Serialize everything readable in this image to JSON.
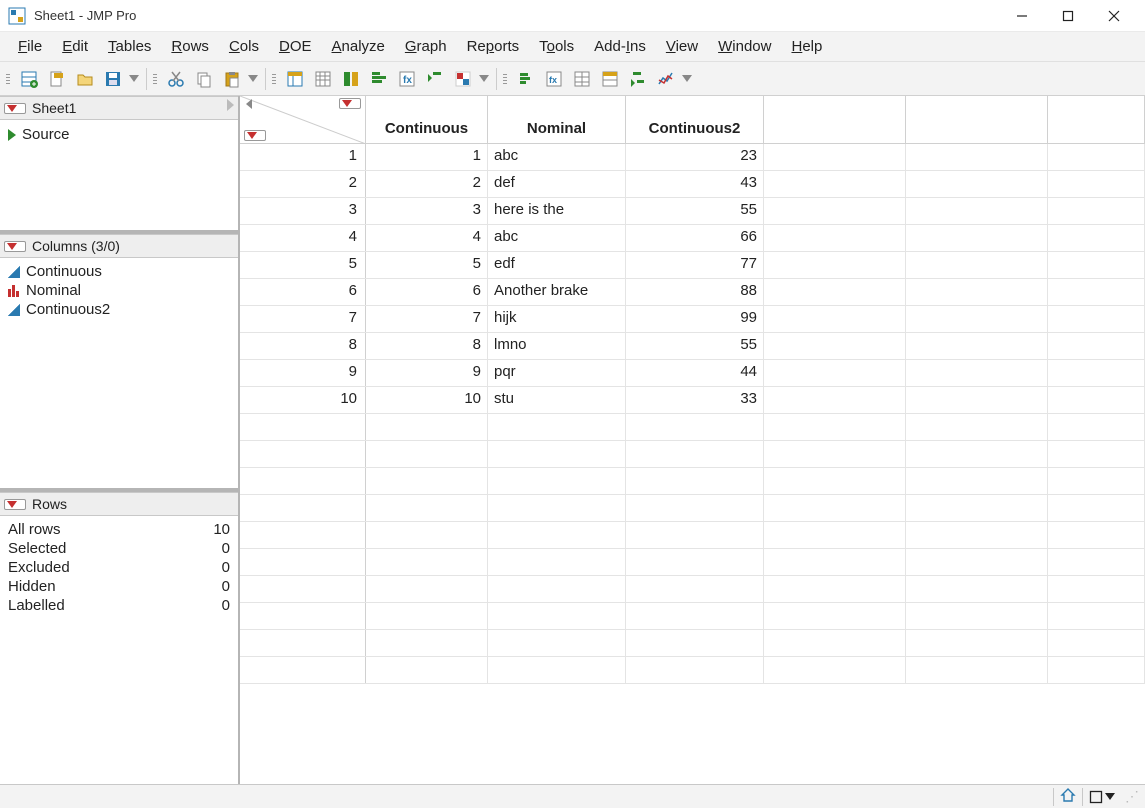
{
  "title": "Sheet1 - JMP Pro",
  "menus": [
    "File",
    "Edit",
    "Tables",
    "Rows",
    "Cols",
    "DOE",
    "Analyze",
    "Graph",
    "Reports",
    "Tools",
    "Add-Ins",
    "View",
    "Window",
    "Help"
  ],
  "menus_accel": [
    "F",
    "E",
    "T",
    "R",
    "C",
    "D",
    "A",
    "G",
    "p",
    "o",
    "I",
    "V",
    "W",
    "H"
  ],
  "toolbar_icons": [
    "new-table-icon",
    "new-script-icon",
    "open-icon",
    "save-icon",
    "cut-icon",
    "copy-icon",
    "paste-icon",
    "show-panels-icon",
    "show-header-icon",
    "split-icon",
    "arrange-icon",
    "formula-icon",
    "selection-icon",
    "color-icon",
    "distribution-icon",
    "fit-y-icon",
    "tabulate-icon",
    "summary-icon",
    "graph-builder-icon",
    "chart-icon"
  ],
  "sheet_name": "Sheet1",
  "source_label": "Source",
  "columns_panel_title": "Columns (3/0)",
  "columns": [
    {
      "name": "Continuous",
      "type": "continuous"
    },
    {
      "name": "Nominal",
      "type": "nominal"
    },
    {
      "name": "Continuous2",
      "type": "continuous"
    }
  ],
  "rows_panel_title": "Rows",
  "row_stats": {
    "All rows": "10",
    "Selected": "0",
    "Excluded": "0",
    "Hidden": "0",
    "Labelled": "0"
  },
  "headers": [
    "Continuous",
    "Nominal",
    "Continuous2"
  ],
  "data_rows": [
    {
      "n": "1",
      "c1": "1",
      "c2": "abc",
      "c3": "23"
    },
    {
      "n": "2",
      "c1": "2",
      "c2": "def",
      "c3": "43"
    },
    {
      "n": "3",
      "c1": "3",
      "c2": "here is the",
      "c3": "55"
    },
    {
      "n": "4",
      "c1": "4",
      "c2": "abc",
      "c3": "66"
    },
    {
      "n": "5",
      "c1": "5",
      "c2": "edf",
      "c3": "77"
    },
    {
      "n": "6",
      "c1": "6",
      "c2": "Another brake",
      "c3": "88"
    },
    {
      "n": "7",
      "c1": "7",
      "c2": "hijk",
      "c3": "99"
    },
    {
      "n": "8",
      "c1": "8",
      "c2": "lmno",
      "c3": "55"
    },
    {
      "n": "9",
      "c1": "9",
      "c2": "pqr",
      "c3": "44"
    },
    {
      "n": "10",
      "c1": "10",
      "c2": "stu",
      "c3": "33"
    }
  ],
  "empty_rows": 10,
  "icon_colors": {
    "accent": "#2a7ab0",
    "red": "#c53030",
    "green": "#2e8b2e",
    "gold": "#d6a21a",
    "gray": "#888"
  }
}
